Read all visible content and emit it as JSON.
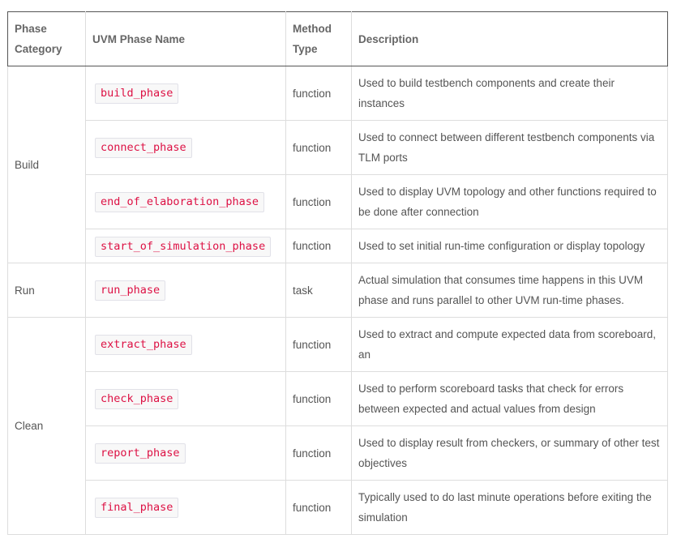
{
  "headers": {
    "category": "Phase Category",
    "name": "UVM Phase Name",
    "method_type": "Method Type",
    "description": "Description"
  },
  "categories": [
    "Build",
    "Run",
    "Clean"
  ],
  "rows": [
    {
      "name": "build_phase",
      "type": "function",
      "desc": "Used to build testbench components and create their instances"
    },
    {
      "name": "connect_phase",
      "type": "function",
      "desc": "Used to connect between different testbench components via TLM ports"
    },
    {
      "name": "end_of_elaboration_phase",
      "type": "function",
      "desc": "Used to display UVM topology and other functions required to be done after connection"
    },
    {
      "name": "start_of_simulation_phase",
      "type": "function",
      "desc": "Used to set initial run-time configuration or display topology"
    },
    {
      "name": "run_phase",
      "type": "task",
      "desc": "Actual simulation that consumes time happens in this UVM phase and runs parallel to other UVM run-time phases."
    },
    {
      "name": "extract_phase",
      "type": "function",
      "desc": "Used to extract and compute expected data from scoreboard, an"
    },
    {
      "name": "check_phase",
      "type": "function",
      "desc": "Used to perform scoreboard tasks that check for errors between expected and actual values from design"
    },
    {
      "name": "report_phase",
      "type": "function",
      "desc": "Used to display result from checkers, or summary of other test objectives"
    },
    {
      "name": "final_phase",
      "type": "function",
      "desc": "Typically used to do last minute operations before exiting the simulation"
    }
  ]
}
